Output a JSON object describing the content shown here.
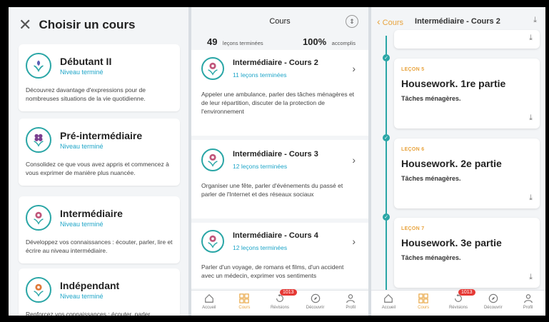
{
  "courses_panel": {
    "title": "Choisir un cours",
    "cards": [
      {
        "title": "Débutant II",
        "status": "Niveau terminé",
        "desc": "Découvrez davantage d'expressions pour de nombreuses situations de la vie quotidienne."
      },
      {
        "title": "Pré-intermédiaire",
        "status": "Niveau terminé",
        "desc": "Consolidez ce que vous avez appris et commencez à vous exprimer de manière plus nuancée."
      },
      {
        "title": "Intermédiaire",
        "status": "Niveau terminé",
        "desc": "Développez vos connaissances : écouter, parler, lire et écrire au niveau intermédiaire."
      },
      {
        "title": "Indépendant",
        "status": "Niveau terminé",
        "desc": "Renforcez vos connaissances : écouter, parler,"
      }
    ]
  },
  "lessons_panel": {
    "title": "Cours",
    "stats": {
      "done_num": "49",
      "done_lbl": "leçons terminées",
      "pct_num": "100%",
      "pct_lbl": "accomplis"
    },
    "items": [
      {
        "title": "Intermédiaire - Cours 2",
        "count": "11 leçons terminées",
        "desc": "Appeler une ambulance, parler des tâches ménagères et de leur répartition, discuter de la protection de l'environnement"
      },
      {
        "title": "Intermédiaire - Cours 3",
        "count": "12 leçons terminées",
        "desc": "Organiser une fête, parler d'événements du passé et parler de l'Internet et des réseaux sociaux"
      },
      {
        "title": "Intermédiaire - Cours 4",
        "count": "12 leçons terminées",
        "desc": "Parler d'un voyage, de romans et films, d'un accident avec un médecin, exprimer vos sentiments"
      }
    ]
  },
  "unit_panel": {
    "back_label": "Cours",
    "title": "Intermédiaire - Cours 2",
    "lessons": [
      {
        "label": "LEÇON 5",
        "title": "Housework. 1re partie",
        "subtitle": "Tâches ménagères."
      },
      {
        "label": "LEÇON 6",
        "title": "Housework. 2e partie",
        "subtitle": "Tâches ménagères."
      },
      {
        "label": "LEÇON 7",
        "title": "Housework. 3e partie",
        "subtitle": "Tâches ménagères."
      }
    ]
  },
  "tabbar": {
    "home": "Accueil",
    "courses": "Cours",
    "reviews": "Révisions",
    "discover": "Découvrir",
    "profile": "Profil",
    "reviews_badge": "1013"
  },
  "colors": {
    "accent": "#e8a33d",
    "teal": "#2aa6a6",
    "link": "#1ea5c8"
  }
}
